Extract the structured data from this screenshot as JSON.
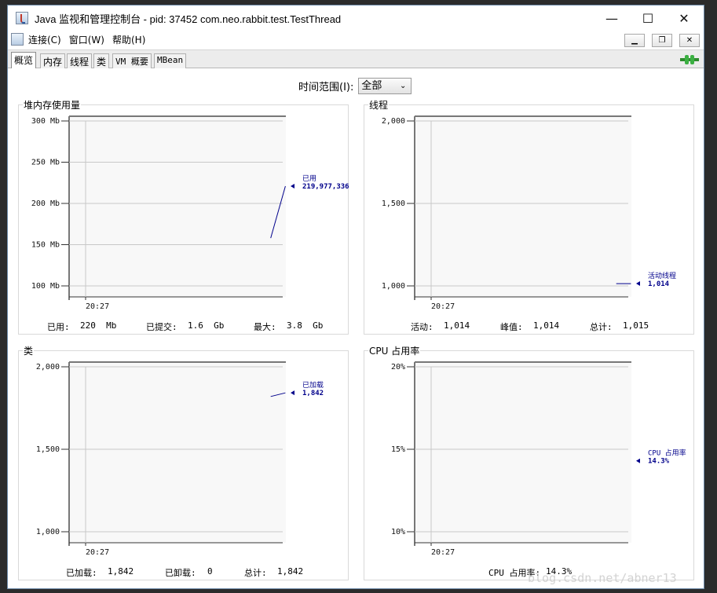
{
  "window": {
    "title": "Java 监视和管理控制台 - pid: 37452 com.neo.rabbit.test.TestThread",
    "minimize_glyph": "—",
    "maximize_glyph": "☐",
    "close_glyph": "✕"
  },
  "menu": {
    "items": [
      "连接(C)",
      "窗口(W)",
      "帮助(H)"
    ]
  },
  "tabs": [
    {
      "label": "概览",
      "active": true
    },
    {
      "label": "内存",
      "active": false
    },
    {
      "label": "线程",
      "active": false
    },
    {
      "label": "类",
      "active": false
    },
    {
      "label": "VM 概要",
      "active": false
    },
    {
      "label": "MBean",
      "active": false
    }
  ],
  "time_range": {
    "label": "时间范围(I):",
    "value": "全部"
  },
  "panels": {
    "heap": {
      "title": "堆内存使用量",
      "stats": {
        "used_label": "已用:",
        "used_value": "220  Mb",
        "committed_label": "已提交:",
        "committed_value": "1.6  Gb",
        "max_label": "最大:",
        "max_value": "3.8  Gb"
      }
    },
    "threads": {
      "title": "线程",
      "stats": {
        "live_label": "活动:",
        "live_value": "1,014",
        "peak_label": "峰值:",
        "peak_value": "1,014",
        "total_label": "总计:",
        "total_value": "1,015"
      }
    },
    "classes": {
      "title": "类",
      "stats": {
        "loaded_label": "已加载:",
        "loaded_value": "1,842",
        "unloaded_label": "已卸载:",
        "unloaded_value": "0",
        "total_label": "总计:",
        "total_value": "1,842"
      }
    },
    "cpu": {
      "title": "CPU 占用率",
      "stats": {
        "usage_label": "CPU 占用率:",
        "usage_value": "14.3%"
      }
    }
  },
  "chart_data": [
    {
      "type": "line",
      "id": "heap",
      "ylim": [
        100,
        300
      ],
      "yticks": [
        "100 Mb",
        "150 Mb",
        "200 Mb",
        "250 Mb",
        "300 Mb"
      ],
      "ytick_values": [
        100,
        150,
        200,
        250,
        300
      ],
      "xticks": [
        "20:27"
      ],
      "series": [
        {
          "name": "已用",
          "values": [
            158,
            221
          ],
          "color": "#00008b"
        }
      ],
      "annotation": {
        "label": "已用",
        "value": "219,977,336",
        "y": 221
      }
    },
    {
      "type": "line",
      "id": "threads",
      "ylim": [
        1000,
        2000
      ],
      "yticks": [
        "1,000",
        "1,500",
        "2,000"
      ],
      "ytick_values": [
        1000,
        1500,
        2000
      ],
      "xticks": [
        "20:27"
      ],
      "series": [
        {
          "name": "活动线程",
          "values": [
            1014,
            1014
          ],
          "color": "#00008b"
        }
      ],
      "annotation": {
        "label": "活动线程",
        "value": "1,014",
        "y": 1014
      }
    },
    {
      "type": "line",
      "id": "classes",
      "ylim": [
        1000,
        2000
      ],
      "yticks": [
        "1,000",
        "1,500",
        "2,000"
      ],
      "ytick_values": [
        1000,
        1500,
        2000
      ],
      "xticks": [
        "20:27"
      ],
      "series": [
        {
          "name": "已加载",
          "values": [
            1820,
            1842
          ],
          "color": "#00008b"
        }
      ],
      "annotation": {
        "label": "已加载",
        "value": "1,842",
        "y": 1842
      }
    },
    {
      "type": "line",
      "id": "cpu",
      "ylim": [
        10,
        20
      ],
      "yticks": [
        "10%",
        "15%",
        "20%"
      ],
      "ytick_values": [
        10,
        15,
        20
      ],
      "xticks": [
        "20:27"
      ],
      "series": [
        {
          "name": "CPU 占用率",
          "values": [],
          "color": "#00008b"
        }
      ],
      "annotation": {
        "label": "CPU 占用率",
        "value": "14.3%",
        "y": 14.3
      }
    }
  ],
  "watermark": "blog.csdn.net/abner13"
}
